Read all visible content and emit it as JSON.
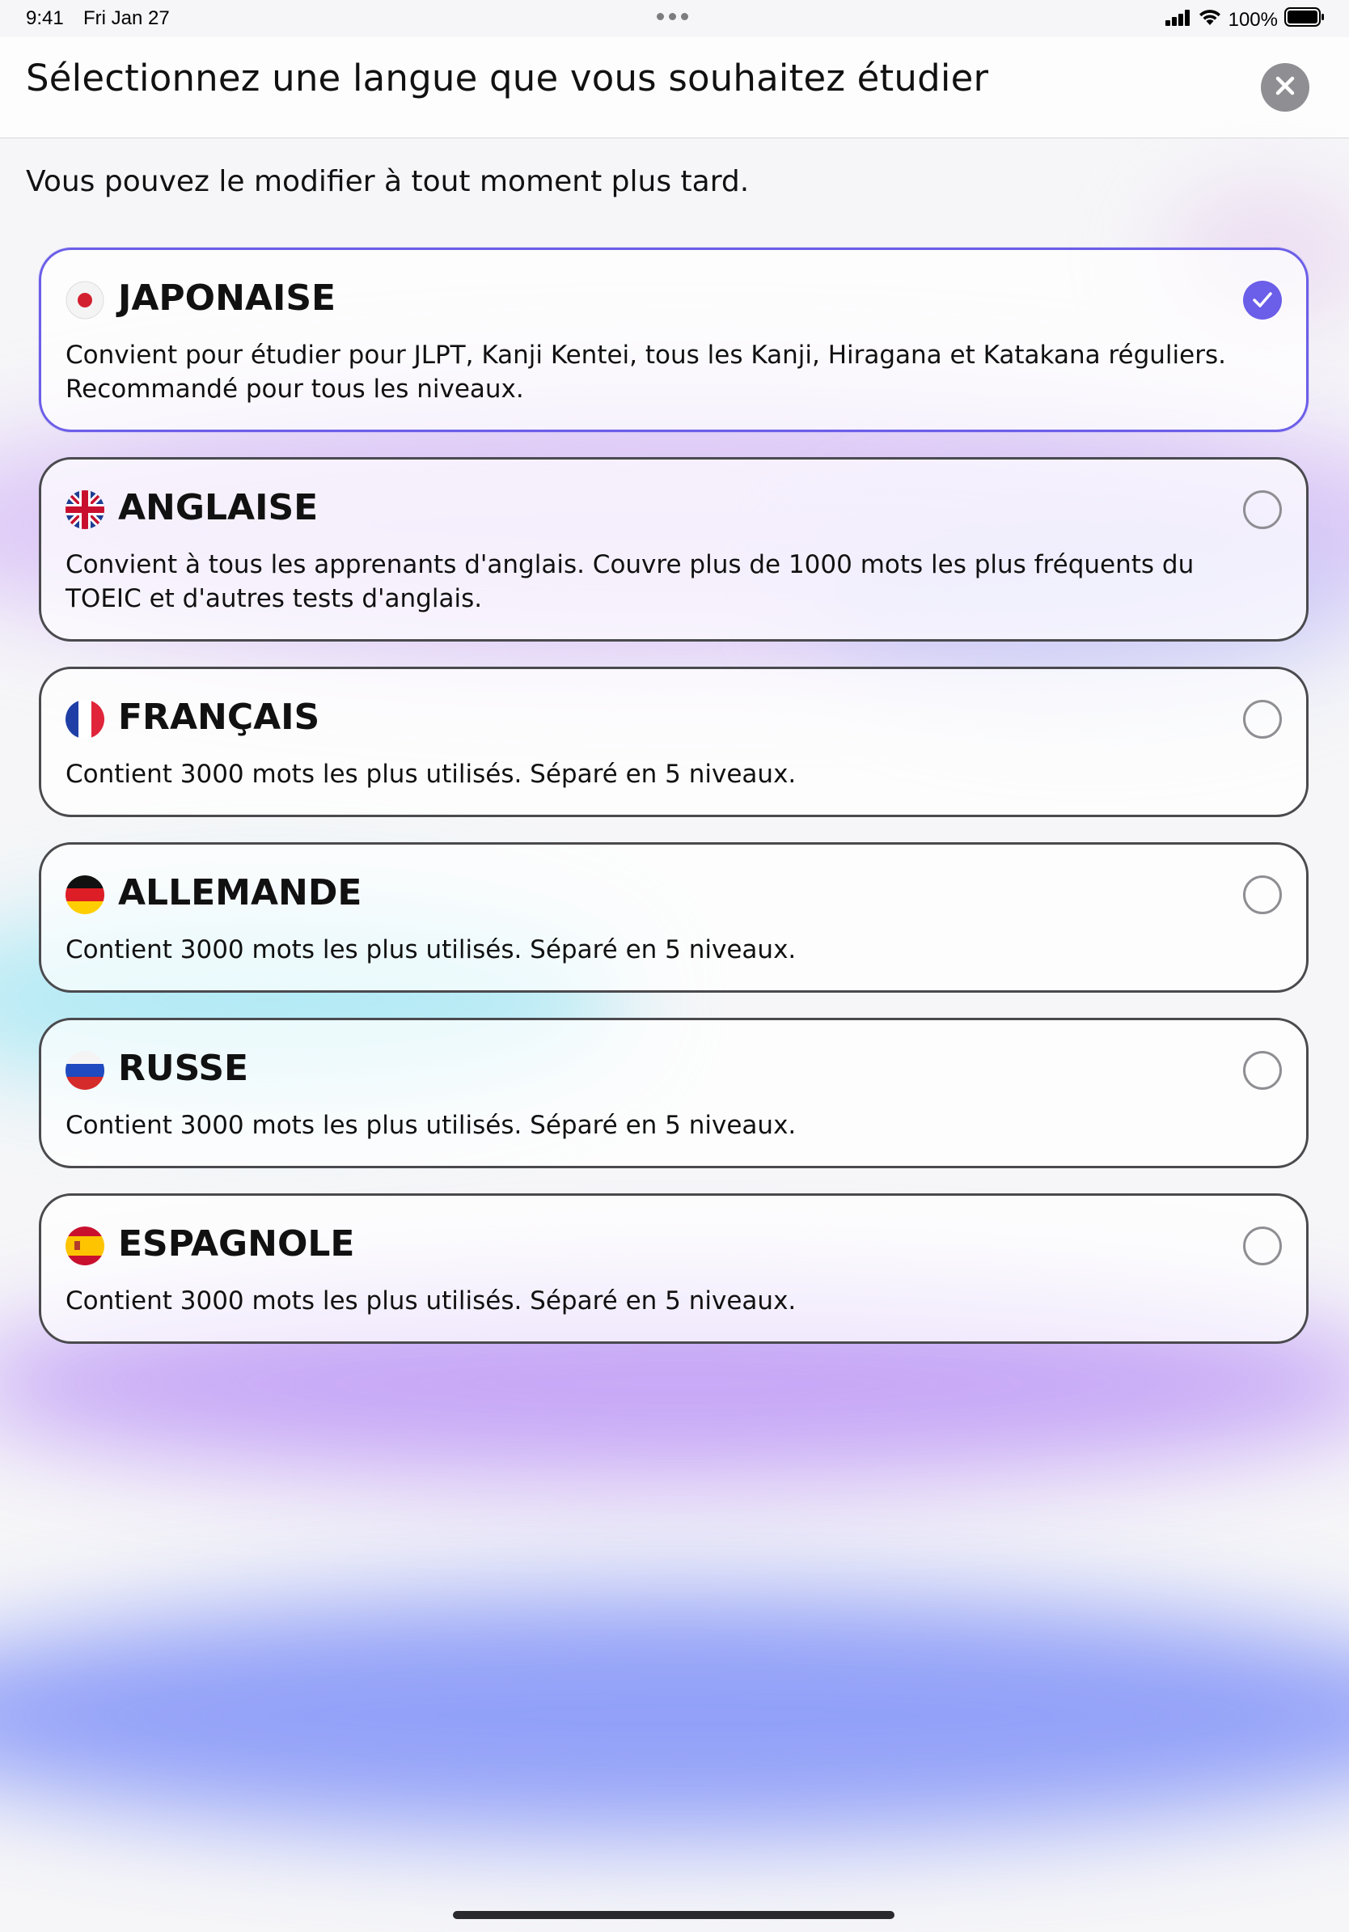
{
  "status_bar": {
    "time": "9:41",
    "date": "Fri Jan 27",
    "battery_label": "100%",
    "icons": [
      "signal-icon",
      "wifi-icon",
      "battery-icon"
    ]
  },
  "header": {
    "title": "Sélectionnez une langue que vous souhaitez étudier",
    "close_icon": "close-icon"
  },
  "subtitle": "Vous pouvez le modifier à tout moment plus tard.",
  "languages": [
    {
      "name": "JAPONAISE",
      "flag_icon": "japan-flag-icon",
      "description": "Convient pour étudier pour JLPT, Kanji Kentei, tous les Kanji, Hiragana et Katakana réguliers. Recommandé pour tous les niveaux.",
      "selected": true
    },
    {
      "name": "ANGLAISE",
      "flag_icon": "uk-flag-icon",
      "description": "Convient à tous les apprenants d'anglais. Couvre plus de 1000 mots les plus fréquents du TOEIC et d'autres tests d'anglais.",
      "selected": false
    },
    {
      "name": "FRANÇAIS",
      "flag_icon": "france-flag-icon",
      "description": "Contient 3000 mots les plus utilisés. Séparé en 5 niveaux.",
      "selected": false
    },
    {
      "name": "ALLEMANDE",
      "flag_icon": "germany-flag-icon",
      "description": "Contient 3000 mots les plus utilisés. Séparé en 5 niveaux.",
      "selected": false
    },
    {
      "name": "RUSSE",
      "flag_icon": "russia-flag-icon",
      "description": "Contient 3000 mots les plus utilisés. Séparé en 5 niveaux.",
      "selected": false
    },
    {
      "name": "ESPAGNOLE",
      "flag_icon": "spain-flag-icon",
      "description": "Contient 3000 mots les plus utilisés. Séparé en 5 niveaux.",
      "selected": false
    }
  ],
  "colors": {
    "accent": "#6b5ee8",
    "card_border": "#4a4a4e",
    "radio_border": "#8e8e93"
  }
}
